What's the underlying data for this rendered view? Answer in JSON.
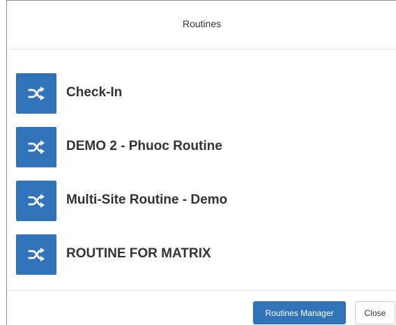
{
  "modal": {
    "title": "Routines"
  },
  "routines": [
    {
      "label": "Check-In",
      "icon": "shuffle-icon"
    },
    {
      "label": "DEMO 2 - Phuoc Routine",
      "icon": "shuffle-icon"
    },
    {
      "label": "Multi-Site Routine - Demo",
      "icon": "shuffle-icon"
    },
    {
      "label": "ROUTINE FOR MATRIX",
      "icon": "shuffle-icon"
    }
  ],
  "footer": {
    "manager_label": "Routines Manager",
    "close_label": "Close"
  },
  "colors": {
    "accent": "#3173b9",
    "text": "#333333",
    "divider": "#e5e5e5"
  }
}
